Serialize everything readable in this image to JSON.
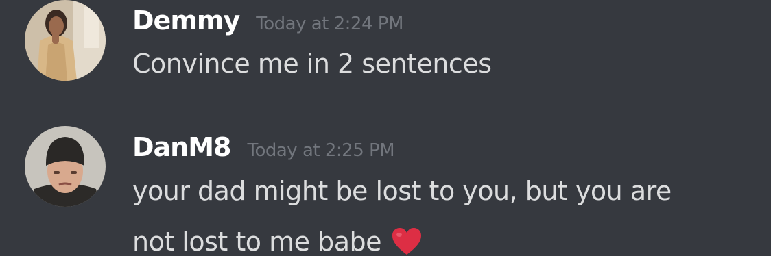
{
  "messages": [
    {
      "username": "Demmy",
      "timestamp": "Today at 2:24 PM",
      "content": "Convince me in 2 sentences",
      "avatar_icon": "user-avatar-hooded-figure"
    },
    {
      "username": "DanM8",
      "timestamp": "Today at 2:25 PM",
      "content_line_1": "your dad might be lost to you, but you are",
      "content_line_2": "not lost to me babe",
      "emoji": "red-heart-emoji",
      "avatar_icon": "user-avatar-beanie-man"
    }
  ],
  "colors": {
    "background": "#36393f",
    "username": "#ffffff",
    "timestamp": "#72767d",
    "message_text": "#dcddde",
    "heart": "#dd2e44"
  }
}
